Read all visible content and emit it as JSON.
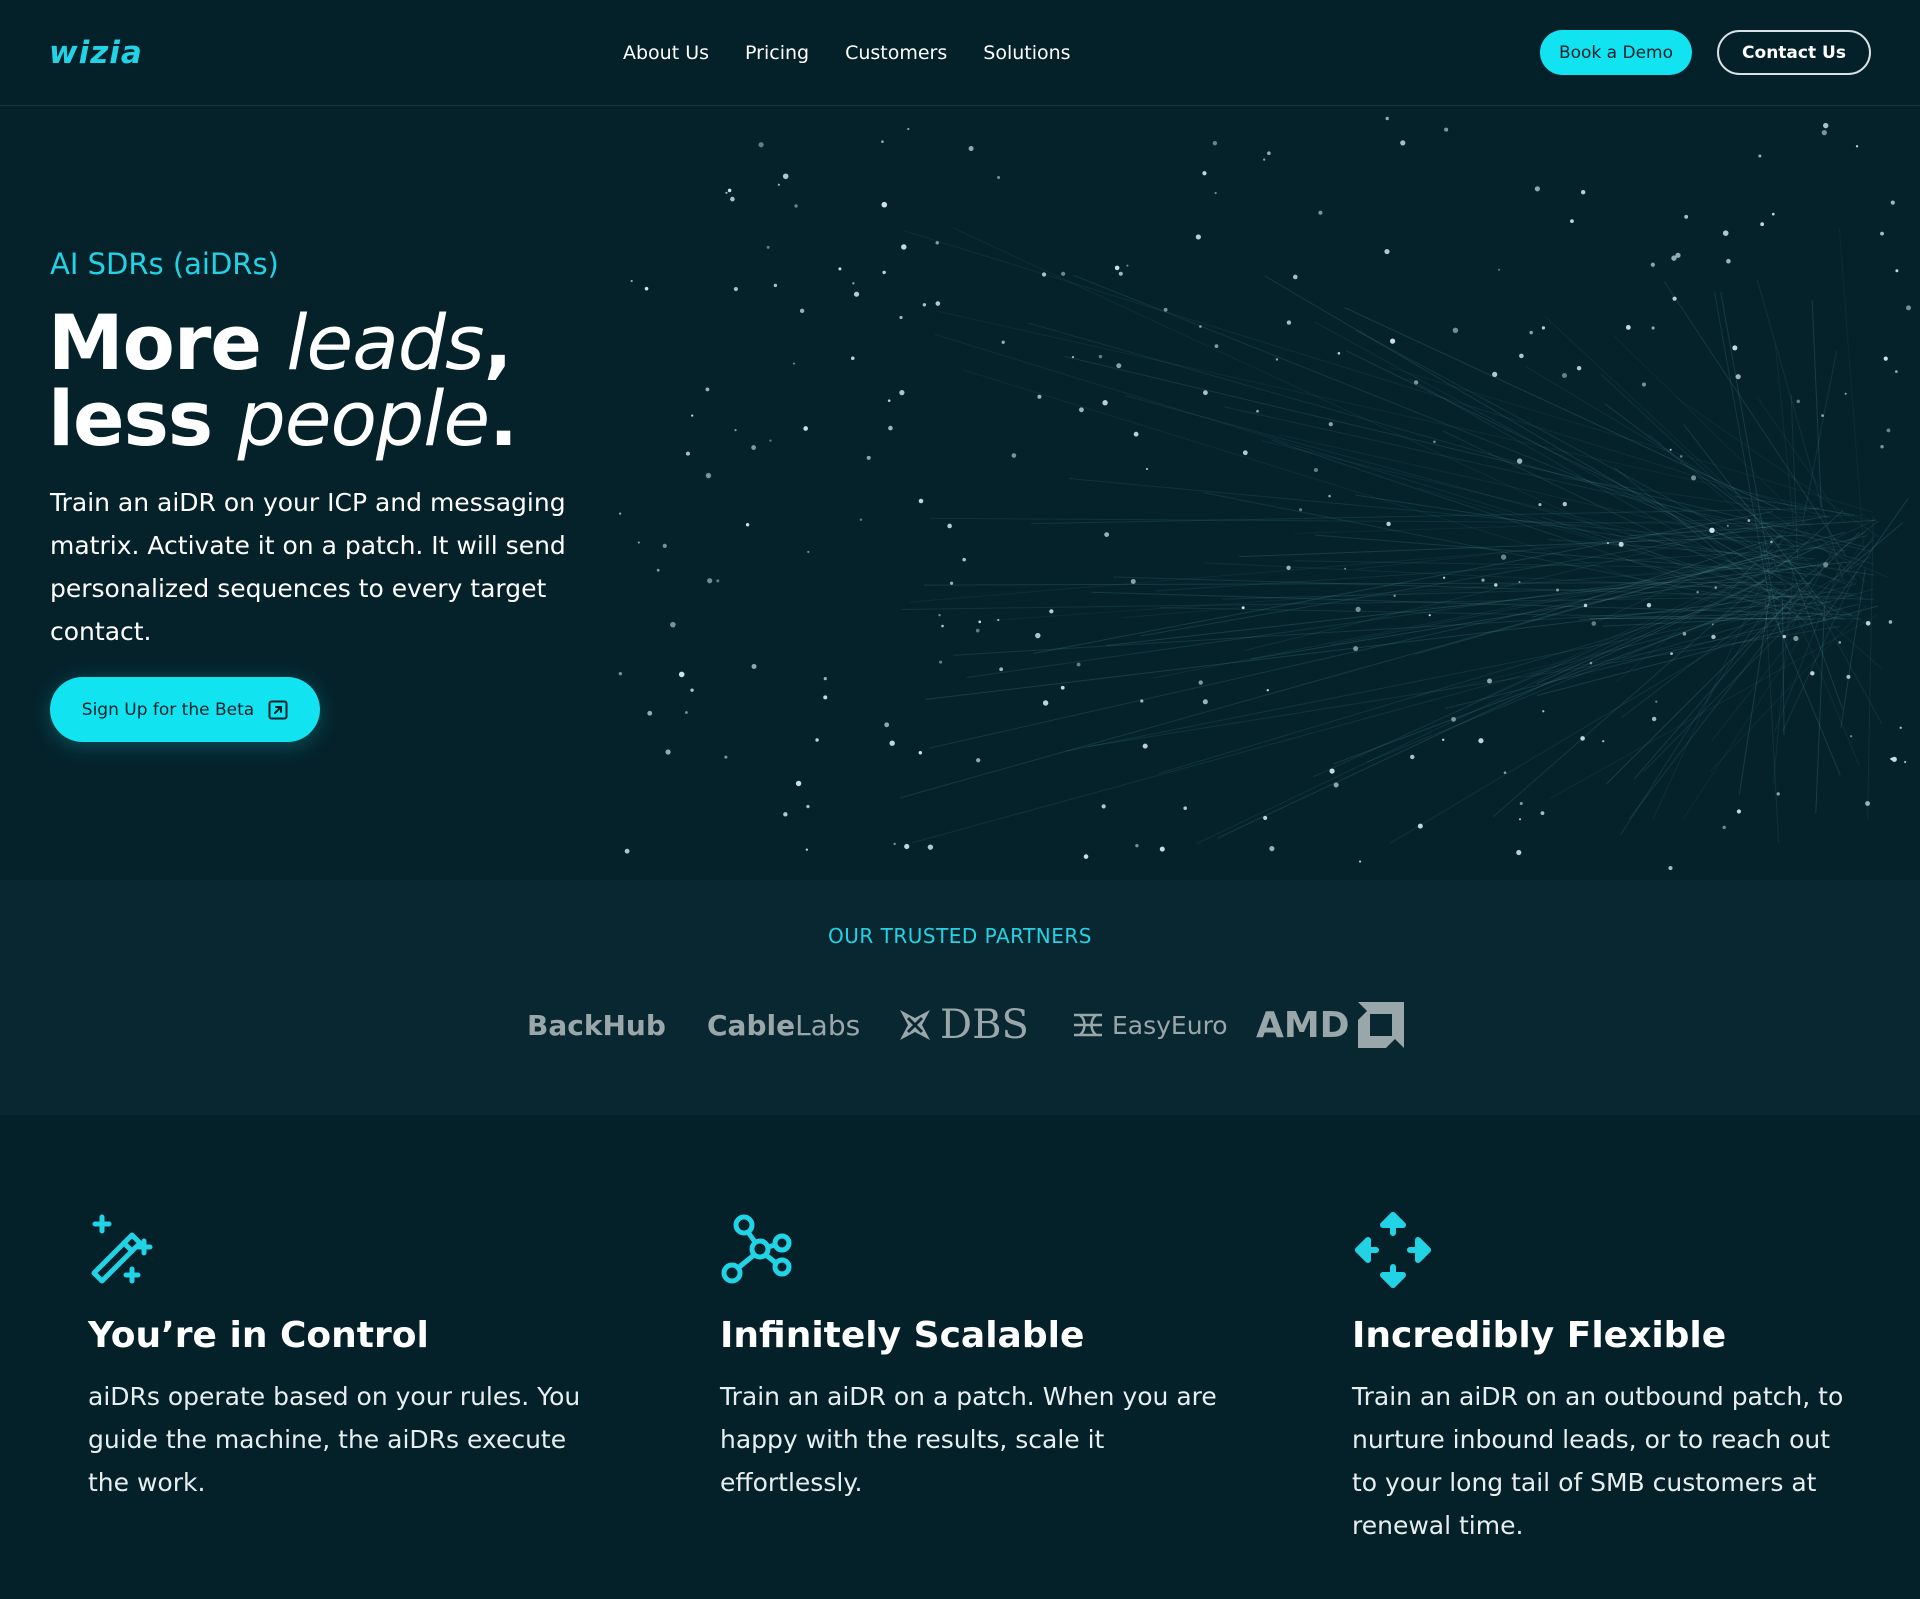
{
  "brand": {
    "logo_text": "wizia",
    "accent": "#12e3f0",
    "background": "#05222b"
  },
  "nav": {
    "links": [
      "About Us",
      "Pricing",
      "Customers",
      "Solutions"
    ],
    "book_demo": "Book a Demo",
    "contact": "Contact Us"
  },
  "hero": {
    "eyebrow": "AI SDRs (aiDRs)",
    "headline_line1_bold": "More",
    "headline_line1_italic": "leads",
    "headline_line1_punct": ",",
    "headline_line2_bold": "less",
    "headline_line2_italic": "people",
    "headline_line2_punct": ".",
    "body": "Train an aiDR on your ICP and messaging matrix. Activate it on a patch. It will send personalized sequences to every target contact.",
    "cta": "Sign Up for the Beta",
    "cta_icon": "external-link-icon"
  },
  "partners": {
    "title": "OUR TRUSTED PARTNERS",
    "logos": [
      "BackHub",
      "CableLabs",
      "DBS",
      "EasyEuro",
      "AMD"
    ],
    "cablelabs_bold": "Cable",
    "cablelabs_light": "Labs"
  },
  "features": [
    {
      "icon": "magic-wand-icon",
      "title": "You’re in Control",
      "body": "aiDRs operate based on your rules. You guide the machine, the aiDRs execute the work."
    },
    {
      "icon": "network-nodes-icon",
      "title": "Infinitely Scalable",
      "body": "Train an aiDR on a patch. When you are happy with the results, scale it effortlessly."
    },
    {
      "icon": "move-arrows-icon",
      "title": "Incredibly Flexible",
      "body": "Train an aiDR on an outbound patch, to nurture inbound leads, or to reach out to your long tail of SMB customers at renewal time."
    }
  ]
}
